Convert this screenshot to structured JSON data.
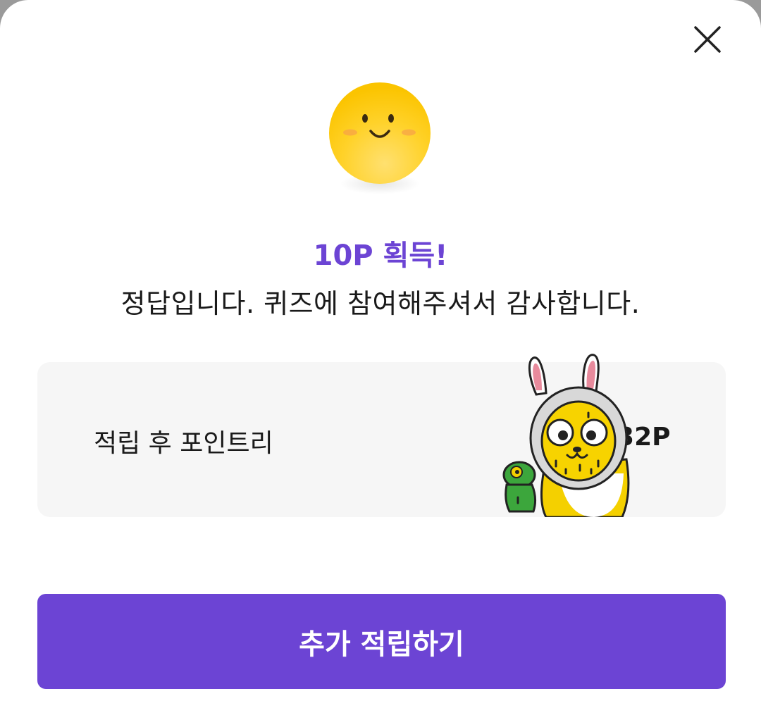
{
  "dialog": {
    "close_icon": "close-icon",
    "result_icon": "smiley-face-icon",
    "title": "10P 획득!",
    "message": "정답입니다. 퀴즈에 참여해주셔서 감사합니다.",
    "colors": {
      "accent": "#6c44d4",
      "card_bg": "#f6f6f6",
      "smiley": "#ffcb05"
    }
  },
  "points_card": {
    "label": "적립 후 포인트리",
    "value": "632P",
    "illustration": "rabbit-hooded-character"
  },
  "cta": {
    "label": "추가 적립하기"
  }
}
